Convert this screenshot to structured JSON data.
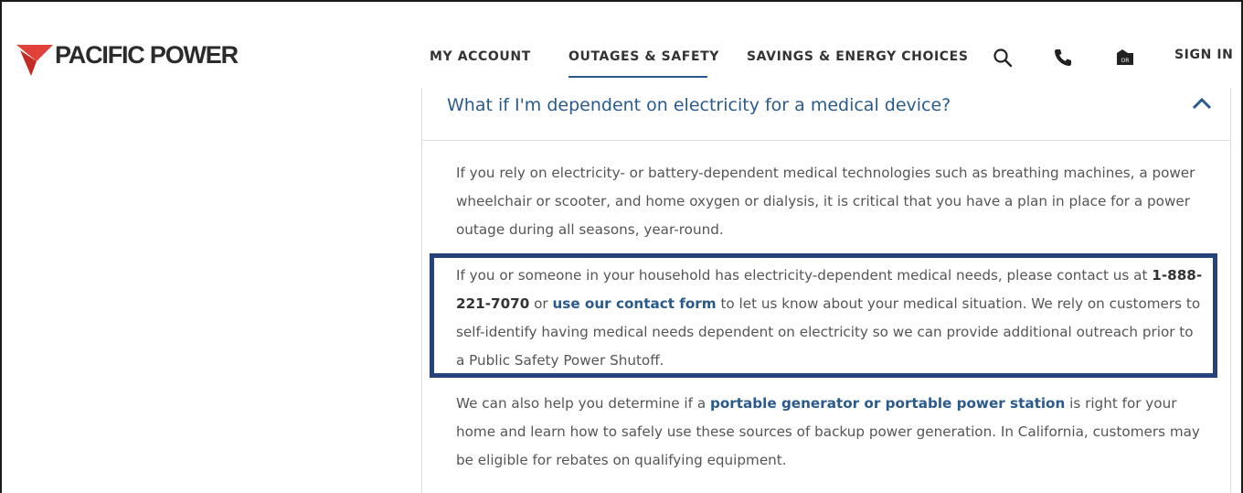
{
  "brand": {
    "name": "PACIFIC POWER",
    "logo_color": "#e0413a"
  },
  "nav": {
    "items": [
      {
        "label": "MY ACCOUNT"
      },
      {
        "label": "OUTAGES & SAFETY",
        "active": true
      },
      {
        "label": "SAVINGS & ENERGY CHOICES"
      }
    ],
    "icons": [
      "search-icon",
      "phone-icon",
      "outage-map-icon"
    ],
    "signin_label": "SIGN IN"
  },
  "accordion": {
    "title": "What if I'm dependent on electricity for a medical device?",
    "expanded": true,
    "paragraph1": "If you rely on electricity- or battery-dependent medical technologies such as breathing machines, a power wheelchair or scooter, and home oxygen or dialysis, it is critical that you have a plan in place for a power outage during all seasons, year-round.",
    "paragraph2": {
      "before": "If you or someone in your household has electricity-dependent medical needs, please contact us at ",
      "phone": "1-888-221-7070",
      "middle": " or ",
      "link": "use our contact form",
      "after": " to let us know about your medical situation. We rely on customers to self-identify having medical needs dependent on electricity so we can provide additional outreach prior to a Public Safety Power Shutoff."
    },
    "paragraph3": {
      "before": "We can also help you determine if a ",
      "link": "portable generator or portable power station",
      "after": " is right for your home and learn how to safely use these sources of backup power generation. In California, customers may be eligible for rebates on qualifying equipment."
    }
  },
  "colors": {
    "link": "#2a5a8c",
    "highlight_border": "#25437a",
    "text": "#555555"
  }
}
